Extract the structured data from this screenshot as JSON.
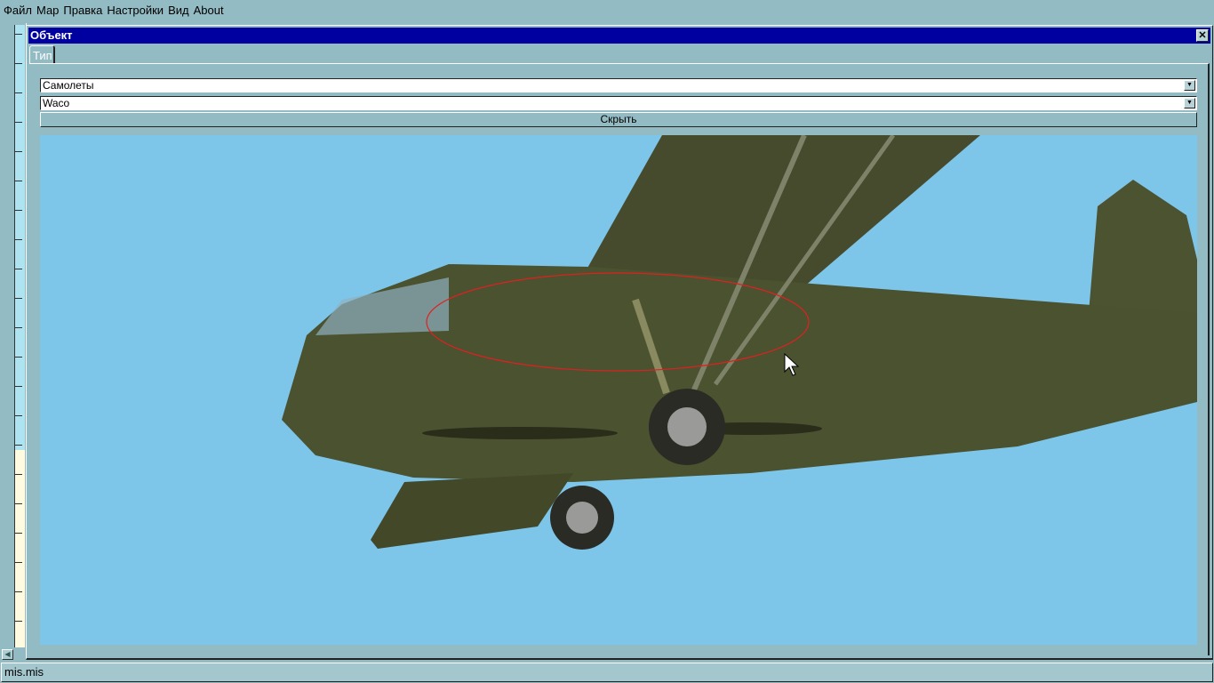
{
  "menu": {
    "items": [
      "Файл",
      "Мар",
      "Правка",
      "Настройки",
      "Вид",
      "About"
    ]
  },
  "window": {
    "title": "Объект",
    "tab": "Тип",
    "category_select": {
      "value": "Самолеты"
    },
    "object_select": {
      "value": "Waco"
    },
    "hide_button": "Скрыть",
    "close_icon": "close-x-icon"
  },
  "viewport": {
    "sky_color": "#7ec5ea",
    "model_color": "#4a5230",
    "highlight_color": "#e02020"
  },
  "statusbar": {
    "text": "mis.mis"
  }
}
